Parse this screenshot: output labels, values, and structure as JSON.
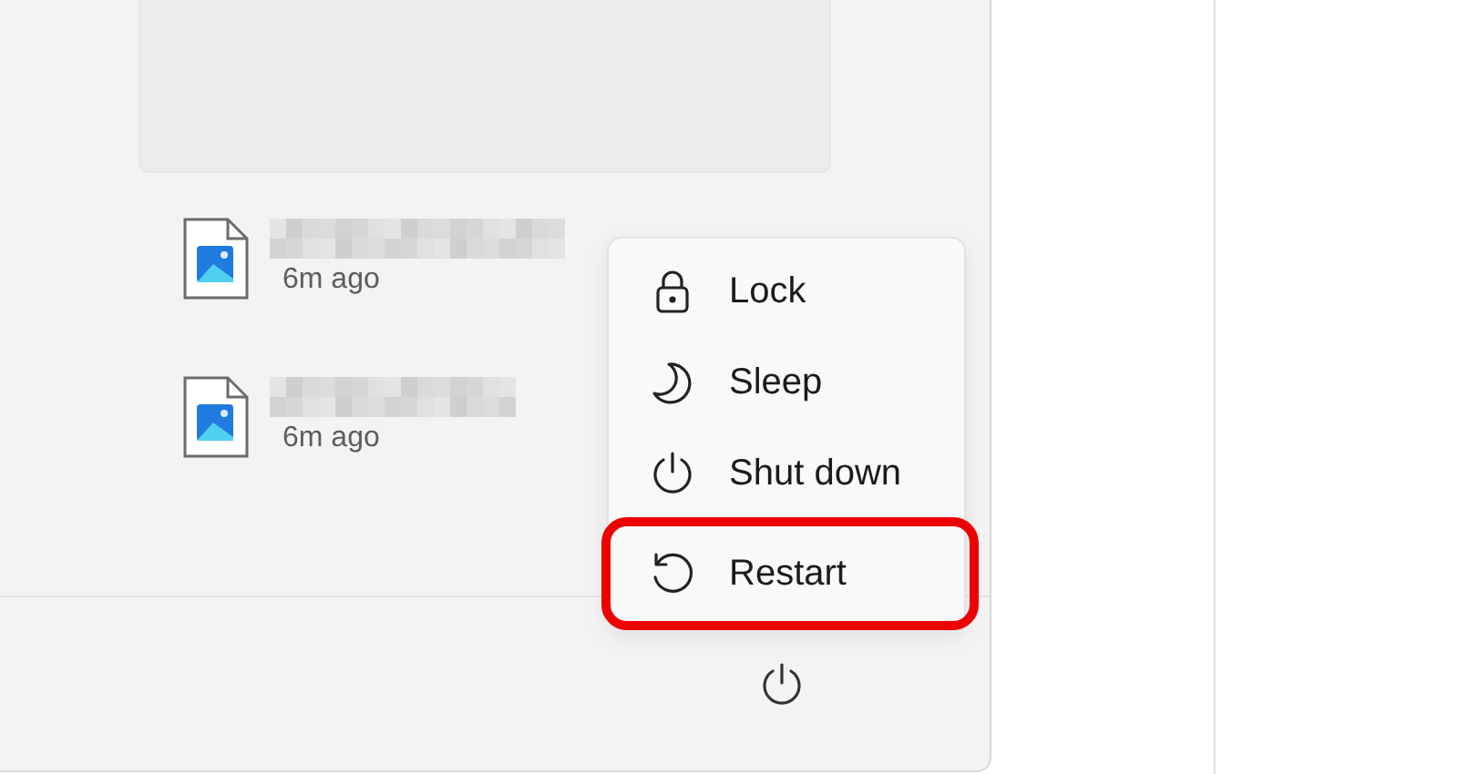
{
  "recent_files": [
    {
      "time": "6m ago"
    },
    {
      "time": "6m ago"
    }
  ],
  "power_menu": {
    "items": [
      {
        "kind": "lock",
        "label": "Lock",
        "highlighted": false
      },
      {
        "kind": "sleep",
        "label": "Sleep",
        "highlighted": false
      },
      {
        "kind": "shutdown",
        "label": "Shut down",
        "highlighted": false
      },
      {
        "kind": "restart",
        "label": "Restart",
        "highlighted": true
      }
    ]
  }
}
